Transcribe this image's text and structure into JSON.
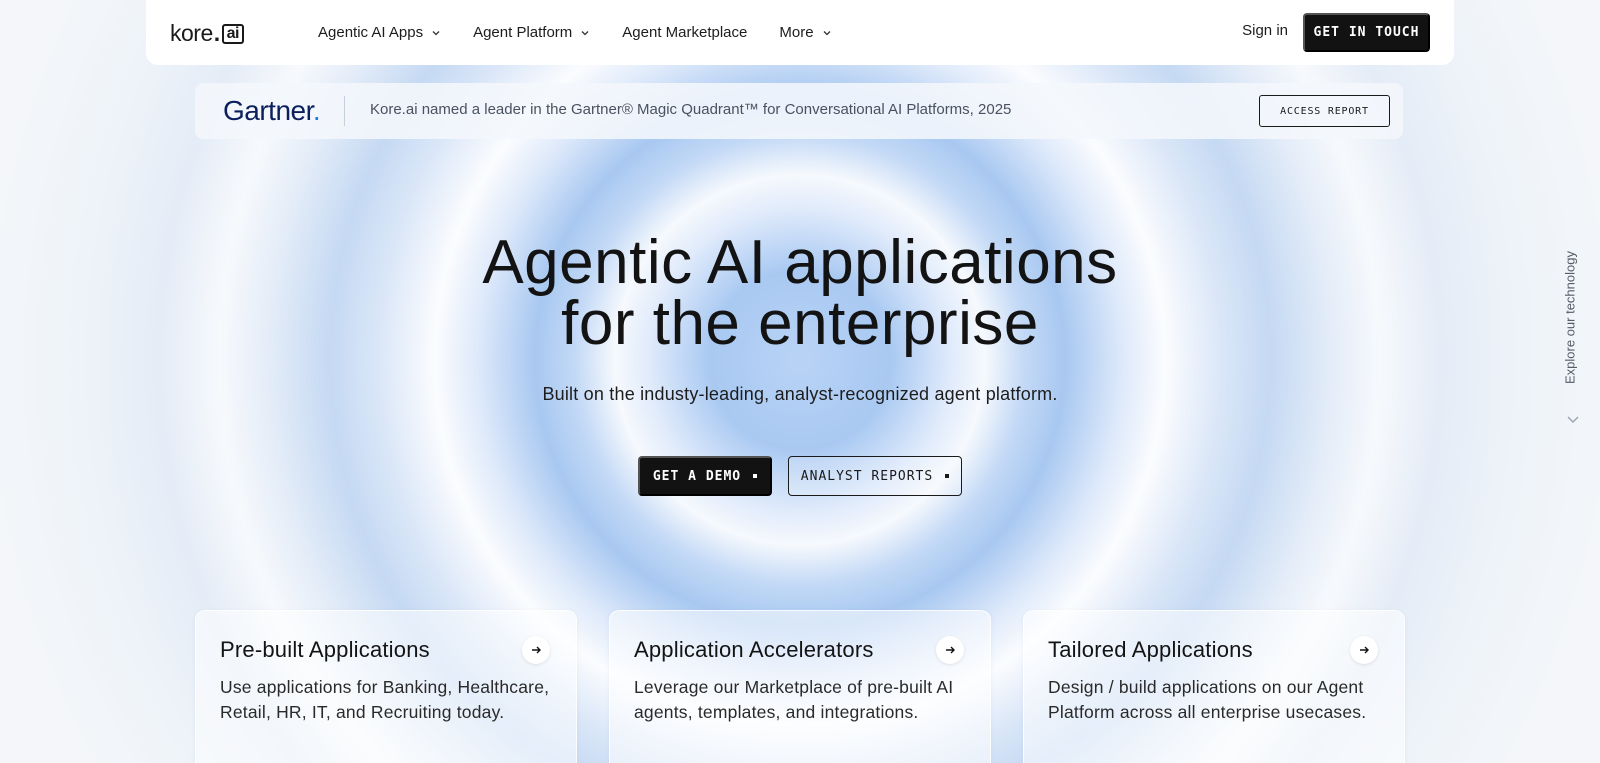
{
  "navbar": {
    "logo_text": "kore",
    "logo_ai": "ai",
    "links": [
      "Agentic AI Apps",
      "Agent Platform",
      "Agent Marketplace",
      "More"
    ],
    "sign_in": "Sign in",
    "cta": "GET IN TOUCH"
  },
  "banner": {
    "brand": "Gartner",
    "text": "Kore.ai named a leader in the Gartner® Magic Quadrant™ for Conversational AI Platforms, 2025",
    "button": "ACCESS REPORT"
  },
  "hero": {
    "title_line1": "Agentic AI applications",
    "title_line2": "for the enterprise",
    "subtitle": "Built on the industy-leading, analyst-recognized agent platform.",
    "primary_button": "GET A DEMO",
    "secondary_button": "ANALYST REPORTS"
  },
  "cards": [
    {
      "title": "Pre-built Applications",
      "description": "Use applications for Banking, Healthcare, Retail, HR, IT, and Recruiting today."
    },
    {
      "title": "Application Accelerators",
      "description": "Leverage our Marketplace of pre-built AI agents, templates, and integrations."
    },
    {
      "title": "Tailored Applications",
      "description": "Design / build applications on our Agent Platform across all enterprise usecases."
    }
  ],
  "side": {
    "label": "Explore our technology"
  },
  "colors": {
    "dark_button": "#121212",
    "gartner_navy": "#0b1f5c",
    "hero_blue": "#a9c9f2"
  }
}
